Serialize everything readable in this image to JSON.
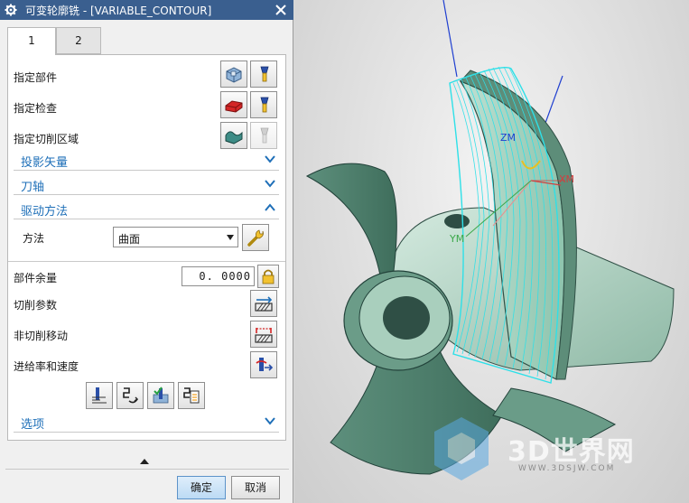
{
  "dialog": {
    "title": "可变轮廓铣 - [VARIABLE_CONTOUR]",
    "title_icon": "gear-icon",
    "close_icon": "close-icon",
    "tabs": [
      {
        "label": "1"
      },
      {
        "label": "2"
      }
    ],
    "rows": {
      "part": {
        "label": "指定部件",
        "icons": [
          "select-part-icon",
          "flashlight-icon"
        ]
      },
      "check": {
        "label": "指定检查",
        "icons": [
          "select-check-icon",
          "flashlight-icon"
        ]
      },
      "cut_area": {
        "label": "指定切削区域",
        "icons": [
          "select-cut-area-icon",
          "flashlight-icon"
        ]
      }
    },
    "sections": {
      "projection_vector": "投影矢量",
      "tool_axis": "刀轴",
      "drive_method": "驱动方法",
      "options": "选项"
    },
    "drive_method": {
      "method_label": "方法",
      "method_value": "曲面",
      "edit_icon": "wrench-icon"
    },
    "stock": {
      "label": "部件余量",
      "value": "0. 0000",
      "lock_icon": "lock-icon"
    },
    "params": [
      {
        "label": "切削参数",
        "icon": "cutting-params-icon"
      },
      {
        "label": "非切削移动",
        "icon": "non-cutting-moves-icon"
      },
      {
        "label": "进给率和速度",
        "icon": "feeds-speeds-icon"
      }
    ],
    "actions_icons": [
      "generate-path-icon",
      "replay-path-icon",
      "verify-path-icon",
      "list-path-icon"
    ],
    "buttons": {
      "ok": "确定",
      "cancel": "取消"
    },
    "colors": {
      "titlebar": "#3a5f8f",
      "section_title": "#1e6fb8",
      "primary_button": "#bcdaf4"
    }
  },
  "viewport": {
    "axes": {
      "zm": "ZM",
      "xm": "XM",
      "ym": "YM"
    },
    "watermark": {
      "text": "3D世界网",
      "sub": "WWW.3DSJW.COM"
    },
    "colors": {
      "part": "#7fae9a",
      "toolpath": "#2ee0e8",
      "z_axis": "#1f3fd0",
      "x_axis": "#d04040",
      "y_axis": "#3aa84a"
    }
  }
}
